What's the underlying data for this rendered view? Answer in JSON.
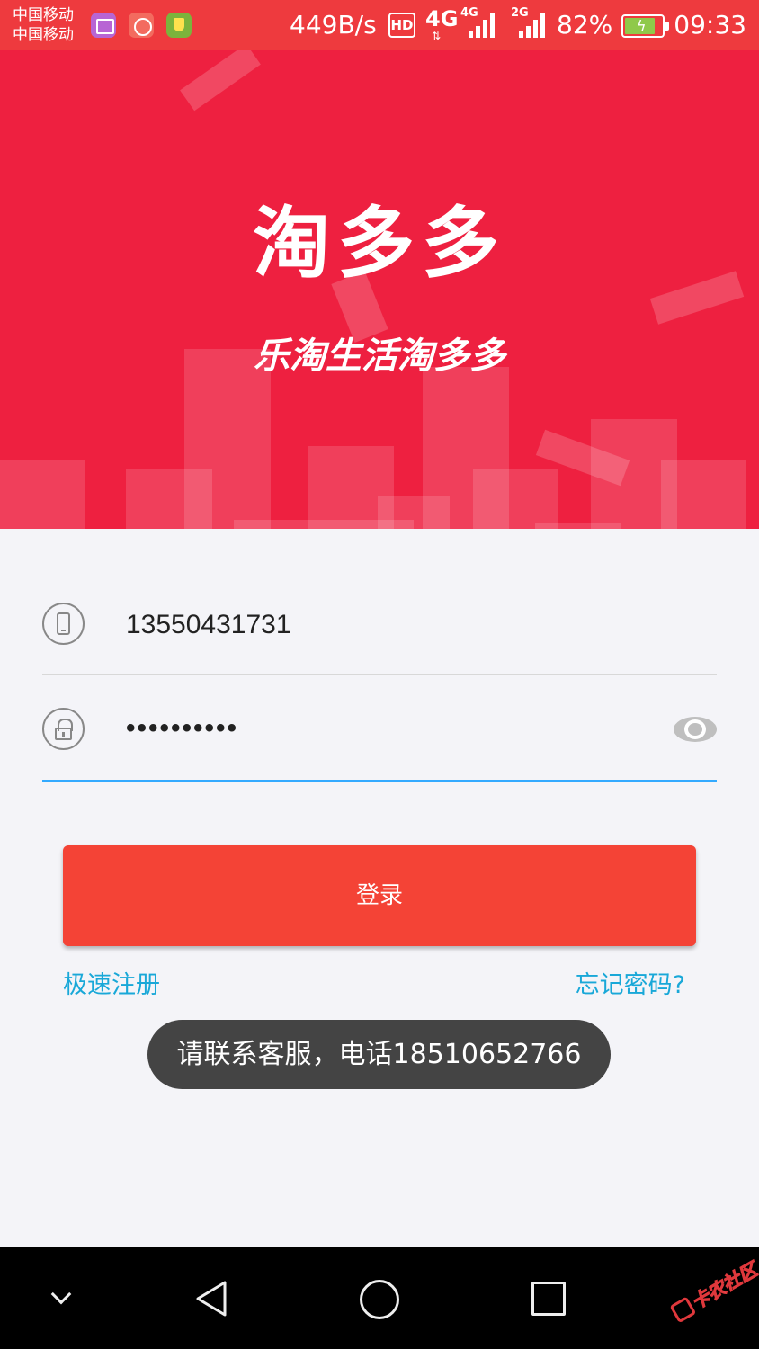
{
  "status_bar": {
    "carrier_1": "中国移动",
    "carrier_2": "中国移动",
    "net_speed": "449B/s",
    "hd_badge": "HD",
    "network_type": "4G",
    "network_arrows": "⇅",
    "sim1_type": "4G",
    "sim2_type": "2G",
    "battery_percent": "82%",
    "battery_level": 0.82,
    "time": "09:33"
  },
  "banner": {
    "title": "淘多多",
    "slogan": "乐淘生活淘多多",
    "background_color": "#ee2040"
  },
  "form": {
    "phone_value": "13550431731",
    "password_value": "••••••••••"
  },
  "actions": {
    "login_label": "登录",
    "register_label": "极速注册",
    "forgot_label": "忘记密码?"
  },
  "toast": {
    "message": "请联系客服，电话18510652766"
  },
  "colors": {
    "status_bar": "#ee3a3e",
    "primary_button": "#f44336",
    "link": "#19a8d8",
    "focused_underline": "#33aaff"
  },
  "watermark": {
    "text": "卡农社区"
  },
  "icons": {
    "phone": "phone-icon",
    "lock": "lock-icon",
    "eye": "eye-icon",
    "nav_back": "triangle-back-icon",
    "nav_home": "circle-home-icon",
    "nav_recent": "square-recent-icon"
  }
}
